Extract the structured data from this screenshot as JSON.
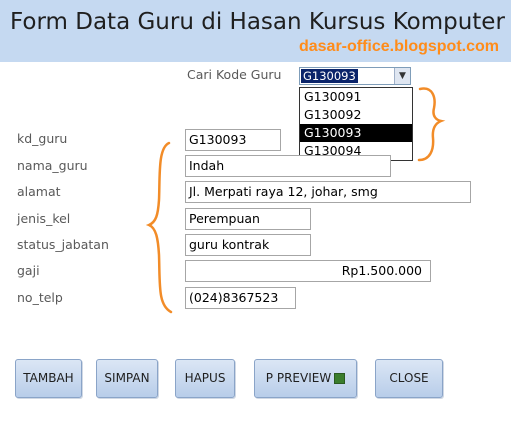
{
  "header": {
    "title": "Form Data Guru di Hasan Kursus Komputer",
    "watermark": "dasar-office.blogspot.com"
  },
  "search": {
    "label": "Cari Kode Guru",
    "selected": "G130093",
    "options": [
      "G130091",
      "G130092",
      "G130093",
      "G130094"
    ]
  },
  "form": {
    "kd_guru": {
      "label": "kd_guru",
      "value": "G130093"
    },
    "nama_guru": {
      "label": "nama_guru",
      "value": "Indah"
    },
    "alamat": {
      "label": "alamat",
      "value": "Jl. Merpati raya 12, johar, smg"
    },
    "jenis_kel": {
      "label": "jenis_kel",
      "value": "Perempuan"
    },
    "status_jabatan": {
      "label": "status_jabatan",
      "value": "guru kontrak"
    },
    "gaji": {
      "label": "gaji",
      "value": "Rp1.500.000"
    },
    "no_telp": {
      "label": "no_telp",
      "value": "(024)8367523"
    }
  },
  "buttons": {
    "tambah": "TAMBAH",
    "simpan": "SIMPAN",
    "hapus": "HAPUS",
    "preview": "P PREVIEW",
    "close": "CLOSE"
  },
  "colors": {
    "header_bg": "#c5d9f1",
    "watermark": "#ff8c1a",
    "annotation": "#f28c28",
    "selection": "#000000"
  }
}
